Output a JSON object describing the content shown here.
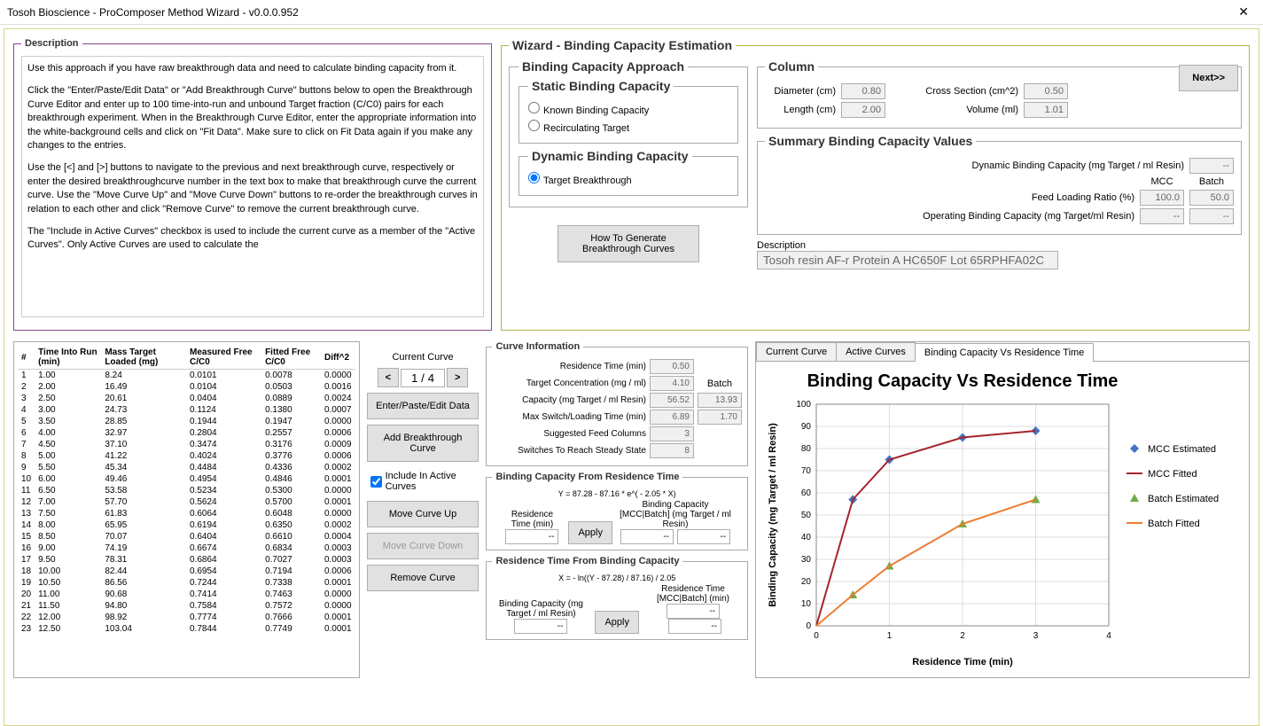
{
  "window": {
    "title": "Tosoh Bioscience - ProComposer Method Wizard - v0.0.0.952"
  },
  "description": {
    "legend": "Description",
    "paragraphs": [
      "Use this approach if you have raw breakthrough data and need to calculate binding capacity from it.",
      "Click the \"Enter/Paste/Edit Data\" or \"Add Breakthrough Curve\" buttons below to open the Breakthrough Curve Editor and enter up to 100 time-into-run and unbound Target fraction (C/C0) pairs for each breakthrough experiment.  When in the Breakthrough Curve Editor, enter the appropriate information into the white-background cells and click on \"Fit Data\".  Make sure to click on Fit Data again if you make any changes to the entries.",
      "Use the [<] and [>] buttons to navigate to the previous and next breakthrough curve, respectively or enter the desired breakthroughcurve number in the text box to make that breakthrough curve the current curve.  Use the \"Move Curve Up\" and \"Move Curve Down\" buttons to re-order the breakthrough curves in relation to each other and click \"Remove Curve\" to remove the current breakthrough curve.",
      "The \"Include in Active Curves\" checkbox is used to include the current curve as a member of the \"Active Curves\".  Only Active Curves are used to calculate the"
    ]
  },
  "wizard": {
    "legend": "Wizard - Binding Capacity Estimation",
    "next": "Next>>",
    "approach": {
      "legend": "Binding Capacity Approach",
      "static_legend": "Static Binding Capacity",
      "opt_known": "Known Binding Capacity",
      "opt_recirc": "Recirculating Target",
      "dynamic_legend": "Dynamic Binding Capacity",
      "opt_target": "Target Breakthrough",
      "howto": "How To Generate Breakthrough Curves"
    },
    "column": {
      "legend": "Column",
      "diameter_lbl": "Diameter (cm)",
      "diameter": "0.80",
      "length_lbl": "Length (cm)",
      "length": "2.00",
      "cross_lbl": "Cross Section (cm^2)",
      "cross": "0.50",
      "volume_lbl": "Volume (ml)",
      "volume": "1.01"
    },
    "summary": {
      "legend": "Summary Binding Capacity Values",
      "dbc_lbl": "Dynamic Binding Capacity (mg Target / ml Resin)",
      "dbc": "--",
      "mcc_hdr": "MCC",
      "batch_hdr": "Batch",
      "flr_lbl": "Feed Loading Ratio (%)",
      "flr_mcc": "100.0",
      "flr_batch": "50.0",
      "obc_lbl": "Operating Binding Capacity (mg Target/ml Resin)",
      "obc_mcc": "--",
      "obc_batch": "--",
      "desc_lbl": "Description",
      "desc_val": "Tosoh resin AF-r Protein A HC650F Lot 65RPHFA02C"
    }
  },
  "table": {
    "headers": [
      "#",
      "Time Into Run (min)",
      "Mass Target Loaded (mg)",
      "Measured Free C/C0",
      "Fitted Free C/C0",
      "Diff^2"
    ],
    "rows": [
      [
        1,
        "1.00",
        "8.24",
        "0.0101",
        "0.0078",
        "0.0000"
      ],
      [
        2,
        "2.00",
        "16.49",
        "0.0104",
        "0.0503",
        "0.0016"
      ],
      [
        3,
        "2.50",
        "20.61",
        "0.0404",
        "0.0889",
        "0.0024"
      ],
      [
        4,
        "3.00",
        "24.73",
        "0.1124",
        "0.1380",
        "0.0007"
      ],
      [
        5,
        "3.50",
        "28.85",
        "0.1944",
        "0.1947",
        "0.0000"
      ],
      [
        6,
        "4.00",
        "32.97",
        "0.2804",
        "0.2557",
        "0.0006"
      ],
      [
        7,
        "4.50",
        "37.10",
        "0.3474",
        "0.3176",
        "0.0009"
      ],
      [
        8,
        "5.00",
        "41.22",
        "0.4024",
        "0.3776",
        "0.0006"
      ],
      [
        9,
        "5.50",
        "45.34",
        "0.4484",
        "0.4336",
        "0.0002"
      ],
      [
        10,
        "6.00",
        "49.46",
        "0.4954",
        "0.4846",
        "0.0001"
      ],
      [
        11,
        "6.50",
        "53.58",
        "0.5234",
        "0.5300",
        "0.0000"
      ],
      [
        12,
        "7.00",
        "57.70",
        "0.5624",
        "0.5700",
        "0.0001"
      ],
      [
        13,
        "7.50",
        "61.83",
        "0.6064",
        "0.6048",
        "0.0000"
      ],
      [
        14,
        "8.00",
        "65.95",
        "0.6194",
        "0.6350",
        "0.0002"
      ],
      [
        15,
        "8.50",
        "70.07",
        "0.6404",
        "0.6610",
        "0.0004"
      ],
      [
        16,
        "9.00",
        "74.19",
        "0.6674",
        "0.6834",
        "0.0003"
      ],
      [
        17,
        "9.50",
        "78.31",
        "0.6864",
        "0.7027",
        "0.0003"
      ],
      [
        18,
        "10.00",
        "82.44",
        "0.6954",
        "0.7194",
        "0.0006"
      ],
      [
        19,
        "10.50",
        "86.56",
        "0.7244",
        "0.7338",
        "0.0001"
      ],
      [
        20,
        "11.00",
        "90.68",
        "0.7414",
        "0.7463",
        "0.0000"
      ],
      [
        21,
        "11.50",
        "94.80",
        "0.7584",
        "0.7572",
        "0.0000"
      ],
      [
        22,
        "12.00",
        "98.92",
        "0.7774",
        "0.7666",
        "0.0001"
      ],
      [
        23,
        "12.50",
        "103.04",
        "0.7844",
        "0.7749",
        "0.0001"
      ]
    ]
  },
  "controls": {
    "current_curve_lbl": "Current Curve",
    "curve_pos": "1 / 4",
    "enter_data": "Enter/Paste/Edit Data",
    "add_curve": "Add Breakthrough Curve",
    "include": "Include In Active Curves",
    "move_up": "Move Curve Up",
    "move_down": "Move Curve Down",
    "remove": "Remove Curve"
  },
  "curve_info": {
    "legend": "Curve Information",
    "rt_lbl": "Residence Time (min)",
    "rt": "0.50",
    "tc_lbl": "Target Concentration  (mg / ml)",
    "tc": "4.10",
    "batch_hdr": "Batch",
    "cap_lbl": "Capacity (mg Target / ml Resin)",
    "cap_mcc": "56.52",
    "cap_batch": "13.93",
    "msl_lbl": "Max Switch/Loading Time (min)",
    "msl_mcc": "6.89",
    "msl_batch": "1.70",
    "sfc_lbl": "Suggested Feed Columns",
    "sfc": "3",
    "sss_lbl": "Switches To Reach Steady State",
    "sss": "8",
    "from_rt": {
      "legend": "Binding Capacity From Residence Time",
      "formula": "Y = 87.28 - 87.16 * e^( - 2.05 * X)",
      "rt_lbl": "Residence Time (min)",
      "bc_lbl": "Binding Capacity [MCC|Batch] (mg Target / ml Resin)",
      "apply": "Apply"
    },
    "from_bc": {
      "legend": "Residence Time From Binding Capacity",
      "formula": "X = - ln((Y - 87.28) / 87.16) / 2.05",
      "bc_lbl": "Binding Capacity (mg Target / ml Resin)",
      "rt_lbl": "Residence Time [MCC|Batch] (min)",
      "apply": "Apply"
    }
  },
  "chart_tabs": [
    "Current Curve",
    "Active Curves",
    "Binding Capacity Vs Residence Time"
  ],
  "chart_data": {
    "type": "line",
    "title": "Binding Capacity Vs Residence Time",
    "xlabel": "Residence Time (min)",
    "ylabel": "Binding Capacity (mg Target / ml Resin)",
    "xlim": [
      0,
      4
    ],
    "ylim": [
      0,
      100
    ],
    "xticks": [
      0,
      1,
      2,
      3,
      4
    ],
    "yticks": [
      0,
      10,
      20,
      30,
      40,
      50,
      60,
      70,
      80,
      90,
      100
    ],
    "series": [
      {
        "name": "MCC Estimated",
        "type": "scatter",
        "marker": "diamond",
        "color": "#4472C4",
        "x": [
          0.5,
          1,
          2,
          3
        ],
        "y": [
          57,
          75,
          85,
          88
        ]
      },
      {
        "name": "MCC Fitted",
        "type": "line",
        "color": "#A5252A",
        "x": [
          0,
          0.5,
          1,
          2,
          3
        ],
        "y": [
          0,
          57,
          75,
          85,
          88
        ]
      },
      {
        "name": "Batch Estimated",
        "type": "scatter",
        "marker": "triangle",
        "color": "#70AD47",
        "x": [
          0.5,
          1,
          2,
          3
        ],
        "y": [
          14,
          27,
          46,
          57
        ]
      },
      {
        "name": "Batch Fitted",
        "type": "line",
        "color": "#ED7D31",
        "x": [
          0,
          0.5,
          1,
          2,
          3
        ],
        "y": [
          0,
          14,
          27,
          46,
          57
        ]
      }
    ],
    "legend_labels": [
      "MCC Estimated",
      "MCC Fitted",
      "Batch Estimated",
      "Batch Fitted"
    ]
  }
}
